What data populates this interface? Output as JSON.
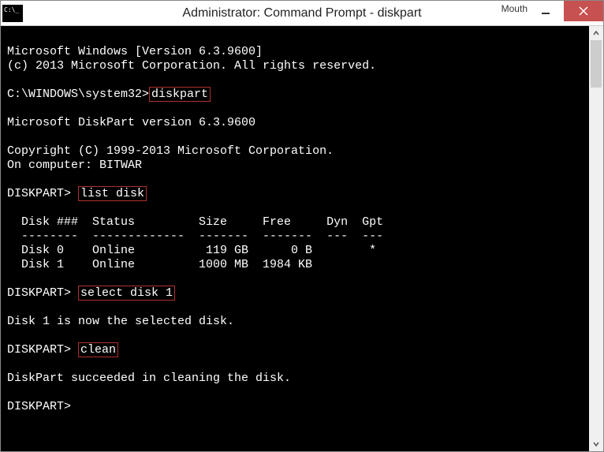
{
  "titlebar": {
    "title": "Administrator: Command Prompt - diskpart",
    "extra_label": "Mouth"
  },
  "console": {
    "ver1": "Microsoft Windows [Version 6.3.9600]",
    "ver2": "(c) 2013 Microsoft Corporation. All rights reserved.",
    "prompt1_path": "C:\\WINDOWS\\system32>",
    "cmd1": "diskpart",
    "dp_ver": "Microsoft DiskPart version 6.3.9600",
    "dp_copy": "Copyright (C) 1999-2013 Microsoft Corporation.",
    "dp_comp": "On computer: BITWAR",
    "dp_prompt": "DISKPART>",
    "cmd2": "list disk",
    "tbl_header": "  Disk ###  Status         Size     Free     Dyn  Gpt",
    "tbl_sep": "  --------  -------------  -------  -------  ---  ---",
    "tbl_row0": "  Disk 0    Online          119 GB      0 B        *",
    "tbl_row1": "  Disk 1    Online         1000 MB  1984 KB",
    "cmd3": "select disk 1",
    "sel_msg": "Disk 1 is now the selected disk.",
    "cmd4": "clean",
    "clean_msg": "DiskPart succeeded in cleaning the disk."
  }
}
